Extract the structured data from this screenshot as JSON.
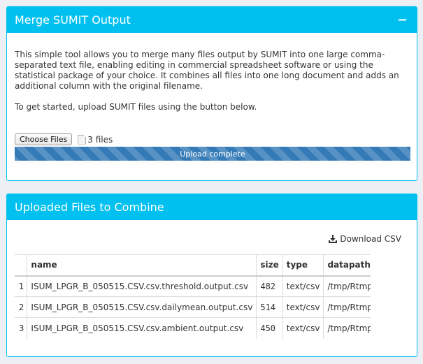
{
  "merge_box": {
    "title": "Merge SUMIT Output",
    "collapse_symbol": "−",
    "description": "This simple tool allows you to merge many files output by SUMIT into one large comma-separated text file, enabling editing in commercial spreadsheet software or using the statistical package of your choice. It combines all files into one long document and adds an additional column with the original filename.",
    "instructions": "To get started, upload SUMIT files using the button below.",
    "choose_button": "Choose Files",
    "file_count": "3 files",
    "progress_label": "Upload complete",
    "progress_value": 1.0
  },
  "uploaded_box": {
    "title": "Uploaded Files to Combine",
    "download_label": "Download CSV",
    "columns": [
      "",
      "name",
      "size",
      "type",
      "datapath"
    ],
    "rows": [
      {
        "idx": "1",
        "name": "ISUM_LPGR_B_050515.CSV.csv.threshold.output.csv",
        "size": "482",
        "type": "text/csv",
        "datapath": "/tmp/Rtmp..."
      },
      {
        "idx": "2",
        "name": "ISUM_LPGR_B_050515.CSV.csv.dailymean.output.csv",
        "size": "514",
        "type": "text/csv",
        "datapath": "/tmp/Rtmp..."
      },
      {
        "idx": "3",
        "name": "ISUM_LPGR_B_050515.CSV.csv.ambient.output.csv",
        "size": "450",
        "type": "text/csv",
        "datapath": "/tmp/Rtmp..."
      }
    ]
  },
  "colors": {
    "header_bg": "#00c0ef",
    "progress_bg": "#337ab7",
    "page_bg": "#ecf0f5"
  }
}
